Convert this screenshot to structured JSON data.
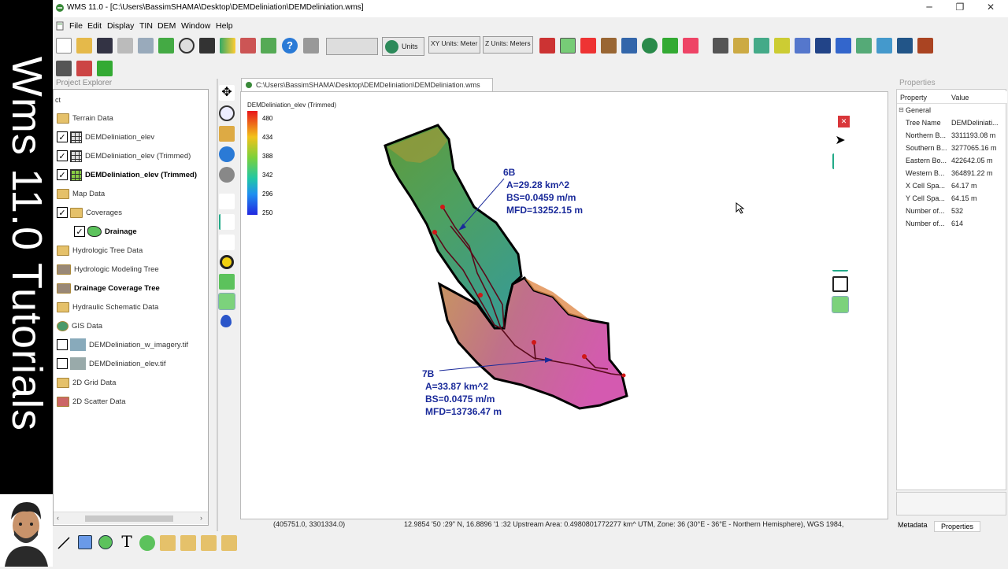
{
  "overlay": {
    "side_title": "Wms 11.0 Tutorials"
  },
  "window": {
    "title": "WMS 11.0 - [C:\\Users\\BassimSHAMA\\Desktop\\DEMDeliniation\\DEMDeliniation.wms]",
    "minimize": "─",
    "restore": "❐",
    "close": "✕"
  },
  "menu": {
    "file": "File",
    "edit": "Edit",
    "display": "Display",
    "tin": "TIN",
    "dem": "DEM",
    "window": "Window",
    "help": "Help"
  },
  "toolbar": {
    "units": "Units",
    "xy_units": "XY Units: Meter",
    "z_units": "Z Units: Meters"
  },
  "project_explorer": {
    "title": "Project Explorer",
    "root": "ct",
    "items": [
      {
        "label": "Terrain Data"
      },
      {
        "label": "DEMDeliniation_elev"
      },
      {
        "label": "DEMDeliniation_elev (Trimmed)"
      },
      {
        "label": "DEMDeliniation_elev (Trimmed)"
      },
      {
        "label": "Map Data"
      },
      {
        "label": "Coverages"
      },
      {
        "label": "Drainage"
      },
      {
        "label": "Hydrologic Tree Data"
      },
      {
        "label": "Hydrologic Modeling Tree"
      },
      {
        "label": "Drainage Coverage Tree"
      },
      {
        "label": "Hydraulic Schematic Data"
      },
      {
        "label": "GIS Data"
      },
      {
        "label": "DEMDeliniation_w_imagery.tif"
      },
      {
        "label": "DEMDeliniation_elev.tif"
      },
      {
        "label": "2D Grid Data"
      },
      {
        "label": "2D Scatter Data"
      }
    ]
  },
  "document": {
    "tab_title": "C:\\Users\\BassimSHAMA\\Desktop\\DEMDeliniation\\DEMDeliniation.wms",
    "legend_title": "DEMDeliniation_elev (Trimmed)",
    "legend": [
      {
        "label": "480",
        "color": "#e8161b"
      },
      {
        "label": "434",
        "color": "#f2c21a"
      },
      {
        "label": "388",
        "color": "#7bd13b"
      },
      {
        "label": "342",
        "color": "#21c7a5"
      },
      {
        "label": "296",
        "color": "#1f8ff0"
      },
      {
        "label": "250",
        "color": "#2228e0"
      }
    ],
    "basin_6b": {
      "name": "6B",
      "area": "A=29.28 km^2",
      "slope": "BS=0.0459 m/m",
      "mfd": "MFD=13252.15 m"
    },
    "basin_7b": {
      "name": "7B",
      "area": "A=33.87 km^2",
      "slope": "BS=0.0475 m/m",
      "mfd": "MFD=13736.47 m"
    }
  },
  "status": {
    "coords": "(405751.0, 3301334.0)",
    "info": "12.9854 '50 :29\" N, 16.8896 '1 :32  Upstream Area: 0.4980801772277 km^ UTM,  Zone: 36 (30°E - 36°E - Northern Hemisphere),  WGS 1984,"
  },
  "properties": {
    "title": "Properties",
    "col_property": "Property",
    "col_value": "Value",
    "group": "General",
    "rows": [
      {
        "k": "Tree Name",
        "v": "DEMDeliniati..."
      },
      {
        "k": "Northern B...",
        "v": "3311193.08 m"
      },
      {
        "k": "Southern B...",
        "v": "3277065.16 m"
      },
      {
        "k": "Eastern Bo...",
        "v": "422642.05 m"
      },
      {
        "k": "Western B...",
        "v": "364891.22 m"
      },
      {
        "k": "X Cell Spa...",
        "v": "64.17 m"
      },
      {
        "k": "Y Cell Spa...",
        "v": "64.15 m"
      },
      {
        "k": "Number of...",
        "v": "532"
      },
      {
        "k": "Number of...",
        "v": "614"
      }
    ],
    "tab_metadata": "Metadata",
    "tab_properties": "Properties"
  }
}
